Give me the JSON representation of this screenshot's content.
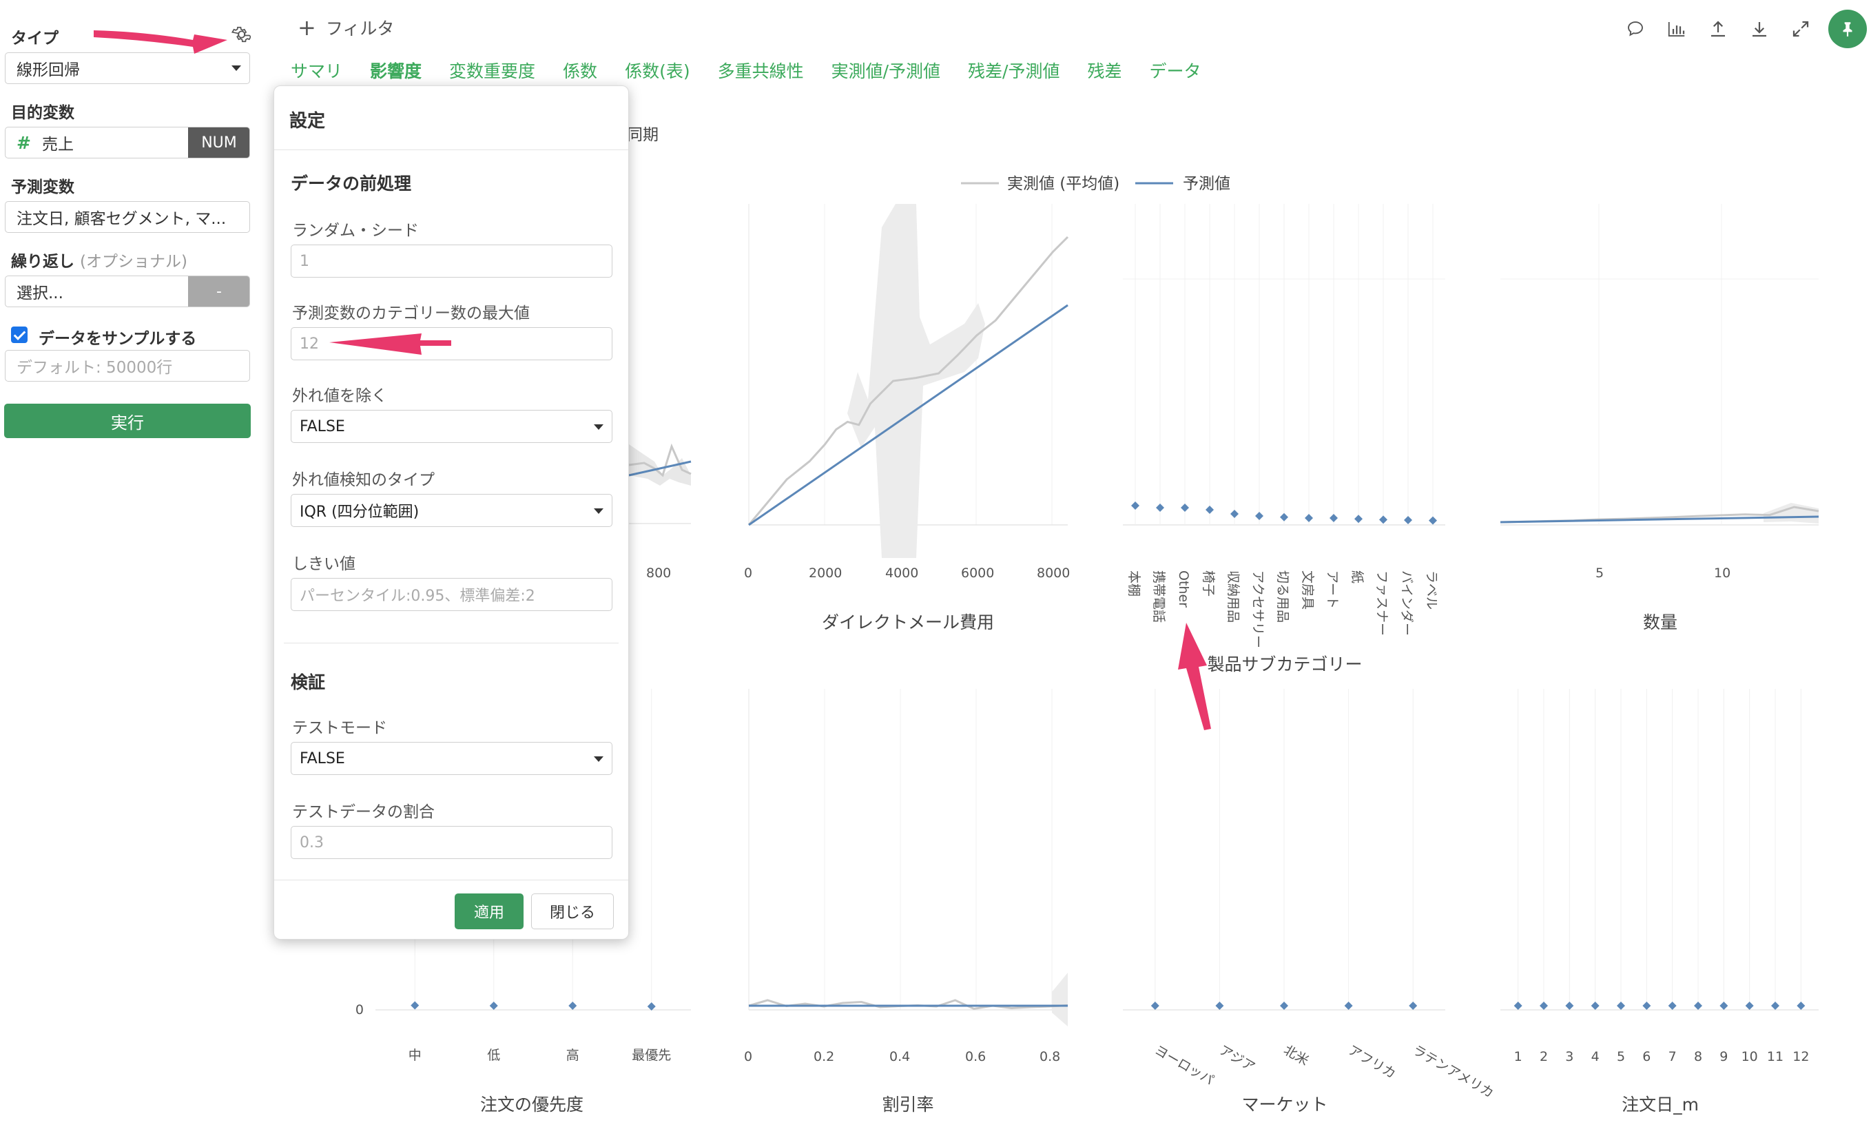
{
  "sidebar": {
    "type_label": "タイプ",
    "type_value": "線形回帰",
    "target_label": "目的変数",
    "target_value": "売上",
    "target_badge": "NUM",
    "predictor_label": "予測変数",
    "predictor_value": "注文日, 顧客セグメント, マ...",
    "repeat_label": "繰り返し",
    "repeat_optional": "(オプショナル)",
    "repeat_value": "選択...",
    "repeat_badge": "-",
    "sample_label": "データをサンプルする",
    "sample_checked": true,
    "sample_placeholder": "デフォルト: 50000行",
    "run_label": "実行"
  },
  "topbar": {
    "filter_label": "フィルタ",
    "tabs": [
      "サマリ",
      "影響度",
      "変数重要度",
      "係数",
      "係数(表)",
      "多重共線性",
      "実測値/予測値",
      "残差/予測値",
      "残差",
      "データ"
    ],
    "active_tab": 1,
    "toolbar_icons": [
      "comment-icon",
      "bar-chart-icon",
      "upload-icon",
      "download-icon",
      "expand-icon",
      "pin-icon"
    ]
  },
  "sync_label": "同期",
  "legend": {
    "actual": "実測値 (平均値)",
    "predicted": "予測値",
    "actual_color": "#c8c8c8",
    "predicted_color": "#5b87b8"
  },
  "dialog": {
    "title": "設定",
    "section_preprocess": "データの前処理",
    "seed_label": "ランダム・シード",
    "seed_placeholder": "1",
    "maxcat_label": "予測変数のカテゴリー数の最大値",
    "maxcat_placeholder": "12",
    "outlier_label": "外れ値を除く",
    "outlier_value": "FALSE",
    "outlier_type_label": "外れ値検知のタイプ",
    "outlier_type_value": "IQR (四分位範囲)",
    "threshold_label": "しきい値",
    "threshold_placeholder": "パーセンタイル:0.95、標準偏差:2",
    "section_validation": "検証",
    "testmode_label": "テストモード",
    "testmode_value": "FALSE",
    "testratio_label": "テストデータの割合",
    "testratio_placeholder": "0.3",
    "apply_label": "適用",
    "close_label": "閉じる"
  },
  "chart_data": [
    {
      "type": "line",
      "xlabel": "",
      "x_ticks": [
        "800"
      ],
      "series": [
        {
          "name": "実測値 (平均値)"
        },
        {
          "name": "予測値"
        }
      ]
    },
    {
      "type": "line",
      "xlabel": "ダイレクトメール費用",
      "x_ticks": [
        "0",
        "2000",
        "4000",
        "6000",
        "8000"
      ],
      "xlim": [
        0,
        8400
      ],
      "series": [
        {
          "name": "実測値 (平均値)",
          "x": [
            0,
            500,
            1000,
            1600,
            2000,
            2300,
            2600,
            2900,
            3200,
            3800,
            4400,
            5000,
            5500,
            6000,
            6500,
            7000,
            7500,
            8000,
            8400
          ],
          "y": [
            0,
            0.15,
            0.3,
            0.42,
            0.53,
            0.63,
            0.68,
            0.66,
            0.8,
            0.95,
            0.97,
            1.0,
            1.12,
            1.25,
            1.35,
            1.5,
            1.65,
            1.8,
            1.9
          ]
        },
        {
          "name": "予測値",
          "x": [
            0,
            8400
          ],
          "y": [
            0,
            1.45
          ]
        }
      ]
    },
    {
      "type": "scatter",
      "xlabel": "製品サブカテゴリー",
      "categories": [
        "本棚",
        "携帯電話",
        "Other",
        "椅子",
        "収納用品",
        "アクセサリー",
        "切る用品",
        "文房具",
        "アート",
        "紙",
        "ファスナー",
        "バインダー",
        "ラベル"
      ],
      "values": [
        0.04,
        0.035,
        0.035,
        0.03,
        0.02,
        0.015,
        0.012,
        0.01,
        0.01,
        0.008,
        0.006,
        0.005,
        0.004
      ]
    },
    {
      "type": "line",
      "xlabel": "数量",
      "x_ticks": [
        "5",
        "10"
      ],
      "xlim": [
        1,
        14
      ],
      "series": [
        {
          "name": "実測値 (平均値)",
          "x": [
            1,
            2,
            3,
            4,
            5,
            6,
            7,
            8,
            9,
            10,
            11,
            12,
            13,
            14
          ],
          "y": [
            0.01,
            0.012,
            0.014,
            0.016,
            0.02,
            0.022,
            0.025,
            0.028,
            0.032,
            0.035,
            0.038,
            0.036,
            0.065,
            0.05
          ]
        },
        {
          "name": "予測値",
          "x": [
            1,
            14
          ],
          "y": [
            0.01,
            0.03
          ]
        }
      ]
    },
    {
      "type": "scatter",
      "xlabel": "注文の優先度",
      "y_ticks": [
        "0"
      ],
      "categories": [
        "中",
        "低",
        "高",
        "最優先"
      ],
      "values": [
        0.005,
        0.004,
        0.004,
        0.002
      ]
    },
    {
      "type": "line",
      "xlabel": "割引率",
      "x_ticks": [
        "0",
        "0.2",
        "0.4",
        "0.6",
        "0.8"
      ],
      "xlim": [
        0,
        0.85
      ],
      "series": [
        {
          "name": "実測値 (平均値)",
          "x": [
            0,
            0.05,
            0.1,
            0.15,
            0.2,
            0.25,
            0.3,
            0.35,
            0.4,
            0.45,
            0.5,
            0.55,
            0.6,
            0.65,
            0.7,
            0.75,
            0.8,
            0.85
          ],
          "y": [
            0.004,
            0.02,
            0.003,
            0.01,
            0.002,
            0.012,
            0.015,
            0.0,
            0.003,
            0.005,
            0.002,
            0.02,
            -0.005,
            0.004,
            -0.003,
            0.0,
            0.002,
            0.005
          ]
        },
        {
          "name": "予測値",
          "x": [
            0,
            0.85
          ],
          "y": [
            0.004,
            0.004
          ]
        }
      ]
    },
    {
      "type": "scatter",
      "xlabel": "マーケット",
      "categories": [
        "ヨーロッパ",
        "アジア",
        "北米",
        "アフリカ",
        "ラテンアメリカ"
      ],
      "values": [
        0.004,
        0.004,
        0.004,
        0.004,
        0.004
      ]
    },
    {
      "type": "scatter",
      "xlabel": "注文日_m",
      "categories": [
        "1",
        "2",
        "3",
        "4",
        "5",
        "6",
        "7",
        "8",
        "9",
        "10",
        "11",
        "12"
      ],
      "values": [
        0.004,
        0.004,
        0.004,
        0.004,
        0.004,
        0.004,
        0.004,
        0.004,
        0.004,
        0.004,
        0.004,
        0.004
      ]
    }
  ]
}
